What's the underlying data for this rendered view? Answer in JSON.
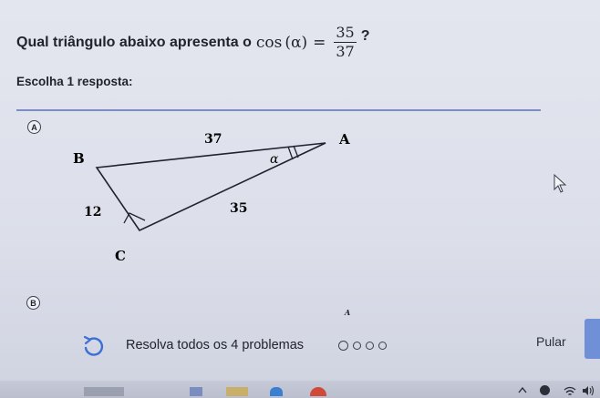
{
  "question": {
    "prefix": "Qual triângulo abaixo apresenta o",
    "math_func": "cos",
    "math_var": "(α)",
    "equals": "=",
    "numerator": "35",
    "denominator": "37",
    "suffix": "?"
  },
  "instruction": "Escolha 1 resposta:",
  "choices": [
    {
      "letter": "A",
      "triangle": {
        "vertex_labels": {
          "A": "A",
          "B": "B",
          "C": "C"
        },
        "side_labels": {
          "hypotenuse": "37",
          "short_leg": "12",
          "long_leg": "35"
        },
        "angle_label": "α"
      }
    },
    {
      "letter": "B",
      "partial_vertex_label": "A"
    }
  ],
  "footer": {
    "message": "Resolva todos os 4 problemas",
    "progress_total": 4,
    "progress_current": 1,
    "skip_label": "Pular"
  },
  "colors": {
    "accent": "#7c8cc4",
    "next_button": "#6f8fd6",
    "text": "#21242c"
  }
}
